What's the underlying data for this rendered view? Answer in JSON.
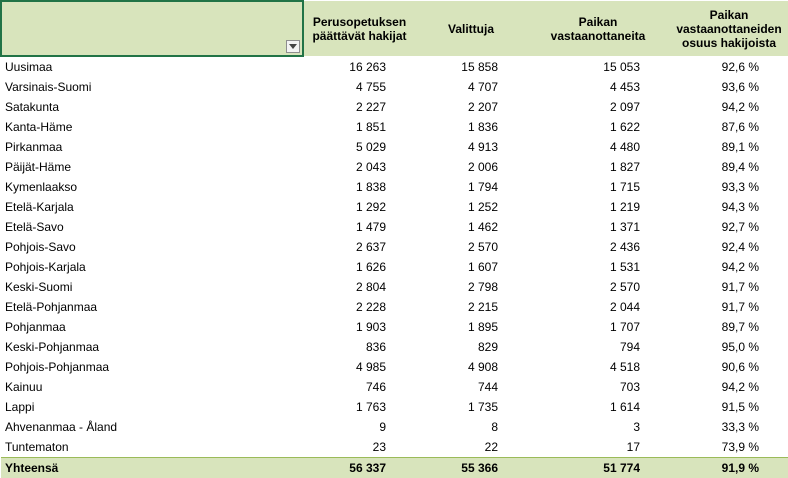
{
  "header": {
    "col1": "Perusopetuksen\npäättävät hakijat",
    "col2": "Valittuja",
    "col3": "Paikan\nvastaanottaneita",
    "col4": "Paikan\nvastaanottaneiden\nosuus hakijoista"
  },
  "filter_icon": "dropdown-arrow-icon",
  "rows": [
    {
      "region": "Uusimaa",
      "hakijat": "16 263",
      "valittuja": "15 858",
      "vastaanottaneita": "15 053",
      "osuus": "92,6 %"
    },
    {
      "region": "Varsinais-Suomi",
      "hakijat": "4 755",
      "valittuja": "4 707",
      "vastaanottaneita": "4 453",
      "osuus": "93,6 %"
    },
    {
      "region": "Satakunta",
      "hakijat": "2 227",
      "valittuja": "2 207",
      "vastaanottaneita": "2 097",
      "osuus": "94,2 %"
    },
    {
      "region": "Kanta-Häme",
      "hakijat": "1 851",
      "valittuja": "1 836",
      "vastaanottaneita": "1 622",
      "osuus": "87,6 %"
    },
    {
      "region": "Pirkanmaa",
      "hakijat": "5 029",
      "valittuja": "4 913",
      "vastaanottaneita": "4 480",
      "osuus": "89,1 %"
    },
    {
      "region": "Päijät-Häme",
      "hakijat": "2 043",
      "valittuja": "2 006",
      "vastaanottaneita": "1 827",
      "osuus": "89,4 %"
    },
    {
      "region": "Kymenlaakso",
      "hakijat": "1 838",
      "valittuja": "1 794",
      "vastaanottaneita": "1 715",
      "osuus": "93,3 %"
    },
    {
      "region": "Etelä-Karjala",
      "hakijat": "1 292",
      "valittuja": "1 252",
      "vastaanottaneita": "1 219",
      "osuus": "94,3 %"
    },
    {
      "region": "Etelä-Savo",
      "hakijat": "1 479",
      "valittuja": "1 462",
      "vastaanottaneita": "1 371",
      "osuus": "92,7 %"
    },
    {
      "region": "Pohjois-Savo",
      "hakijat": "2 637",
      "valittuja": "2 570",
      "vastaanottaneita": "2 436",
      "osuus": "92,4 %"
    },
    {
      "region": "Pohjois-Karjala",
      "hakijat": "1 626",
      "valittuja": "1 607",
      "vastaanottaneita": "1 531",
      "osuus": "94,2 %"
    },
    {
      "region": "Keski-Suomi",
      "hakijat": "2 804",
      "valittuja": "2 798",
      "vastaanottaneita": "2 570",
      "osuus": "91,7 %"
    },
    {
      "region": "Etelä-Pohjanmaa",
      "hakijat": "2 228",
      "valittuja": "2 215",
      "vastaanottaneita": "2 044",
      "osuus": "91,7 %"
    },
    {
      "region": "Pohjanmaa",
      "hakijat": "1 903",
      "valittuja": "1 895",
      "vastaanottaneita": "1 707",
      "osuus": "89,7 %"
    },
    {
      "region": "Keski-Pohjanmaa",
      "hakijat": "836",
      "valittuja": "829",
      "vastaanottaneita": "794",
      "osuus": "95,0 %"
    },
    {
      "region": "Pohjois-Pohjanmaa",
      "hakijat": "4 985",
      "valittuja": "4 908",
      "vastaanottaneita": "4 518",
      "osuus": "90,6 %"
    },
    {
      "region": "Kainuu",
      "hakijat": "746",
      "valittuja": "744",
      "vastaanottaneita": "703",
      "osuus": "94,2 %"
    },
    {
      "region": "Lappi",
      "hakijat": "1 763",
      "valittuja": "1 735",
      "vastaanottaneita": "1 614",
      "osuus": "91,5 %"
    },
    {
      "region": "Ahvenanmaa - Åland",
      "hakijat": "9",
      "valittuja": "8",
      "vastaanottaneita": "3",
      "osuus": "33,3 %"
    },
    {
      "region": "Tuntematon",
      "hakijat": "23",
      "valittuja": "22",
      "vastaanottaneita": "17",
      "osuus": "73,9 %"
    }
  ],
  "total": {
    "region": "Yhteensä",
    "hakijat": "56 337",
    "valittuja": "55 366",
    "vastaanottaneita": "51 774",
    "osuus": "91,9 %"
  },
  "colors": {
    "header_bg": "#d8e4bc",
    "selection_border": "#217346",
    "total_border": "#9bbb59"
  }
}
